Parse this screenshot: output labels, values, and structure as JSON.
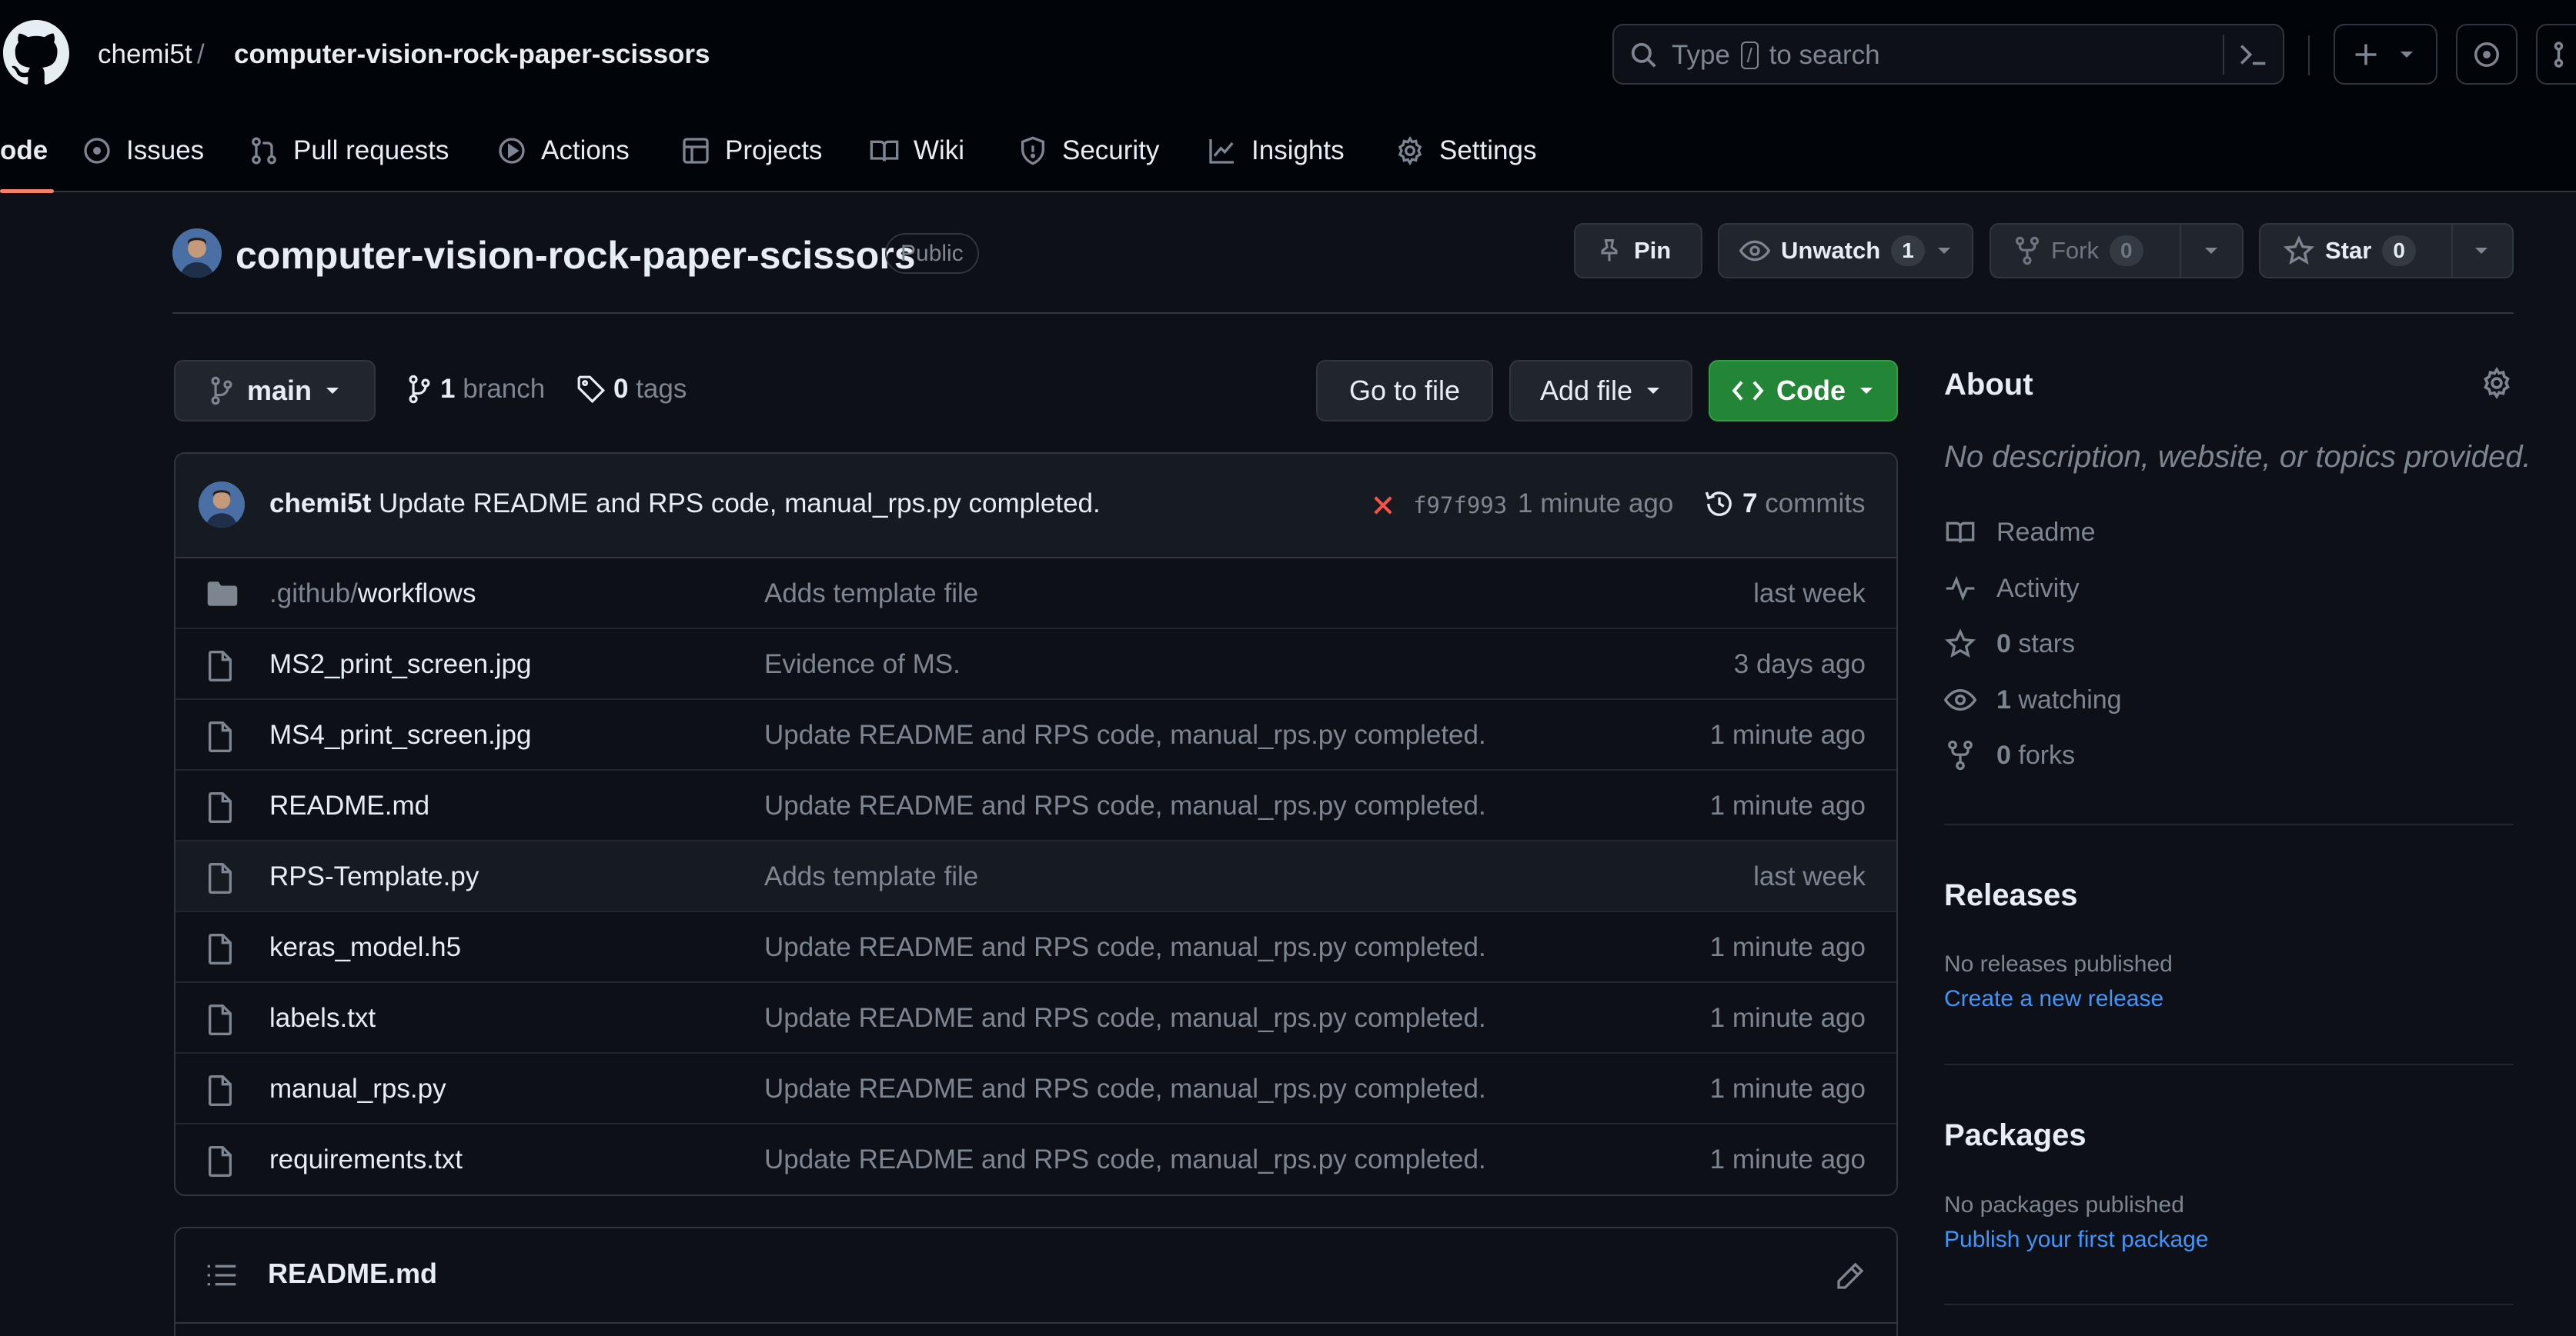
{
  "header": {
    "owner": "chemi5t",
    "separator": "/",
    "repo": "computer-vision-rock-paper-scissors",
    "search": {
      "prefix": "Type",
      "key": "/",
      "suffix": "to search"
    }
  },
  "tabs": [
    {
      "label": "ode",
      "icon": "code-icon"
    },
    {
      "label": "Issues",
      "icon": "issue-icon"
    },
    {
      "label": "Pull requests",
      "icon": "pull-request-icon"
    },
    {
      "label": "Actions",
      "icon": "play-icon"
    },
    {
      "label": "Projects",
      "icon": "table-icon"
    },
    {
      "label": "Wiki",
      "icon": "book-icon"
    },
    {
      "label": "Security",
      "icon": "shield-icon"
    },
    {
      "label": "Insights",
      "icon": "graph-icon"
    },
    {
      "label": "Settings",
      "icon": "gear-icon"
    }
  ],
  "repo_head": {
    "title": "computer-vision-rock-paper-scissors",
    "visibility": "Public",
    "pin_label": "Pin",
    "unwatch_label": "Unwatch",
    "watch_count": "1",
    "fork_label": "Fork",
    "fork_count": "0",
    "star_label": "Star",
    "star_count": "0"
  },
  "filebar": {
    "branch": "main",
    "branch_count": "1",
    "branch_label": "branch",
    "tag_count": "0",
    "tag_label": "tags",
    "go_to_file": "Go to file",
    "add_file": "Add file",
    "code": "Code"
  },
  "latest_commit": {
    "author": "chemi5t",
    "message": "Update README and RPS code, manual_rps.py completed.",
    "sha": "f97f993",
    "time": "1 minute ago",
    "commit_count": "7",
    "commit_label": "commits"
  },
  "files": [
    {
      "dir_prefix": ".github/",
      "name": "workflows",
      "type": "folder",
      "commit": "Adds template file",
      "age": "last week"
    },
    {
      "dir_prefix": "",
      "name": "MS2_print_screen.jpg",
      "type": "file",
      "commit": "Evidence of MS.",
      "age": "3 days ago"
    },
    {
      "dir_prefix": "",
      "name": "MS4_print_screen.jpg",
      "type": "file",
      "commit": "Update README and RPS code, manual_rps.py completed.",
      "age": "1 minute ago"
    },
    {
      "dir_prefix": "",
      "name": "README.md",
      "type": "file",
      "commit": "Update README and RPS code, manual_rps.py completed.",
      "age": "1 minute ago"
    },
    {
      "dir_prefix": "",
      "name": "RPS-Template.py",
      "type": "file",
      "commit": "Adds template file",
      "age": "last week"
    },
    {
      "dir_prefix": "",
      "name": "keras_model.h5",
      "type": "file",
      "commit": "Update README and RPS code, manual_rps.py completed.",
      "age": "1 minute ago"
    },
    {
      "dir_prefix": "",
      "name": "labels.txt",
      "type": "file",
      "commit": "Update README and RPS code, manual_rps.py completed.",
      "age": "1 minute ago"
    },
    {
      "dir_prefix": "",
      "name": "manual_rps.py",
      "type": "file",
      "commit": "Update README and RPS code, manual_rps.py completed.",
      "age": "1 minute ago"
    },
    {
      "dir_prefix": "",
      "name": "requirements.txt",
      "type": "file",
      "commit": "Update README and RPS code, manual_rps.py completed.",
      "age": "1 minute ago"
    }
  ],
  "readme": {
    "title": "README.md"
  },
  "sidebar": {
    "about_title": "About",
    "description": "No description, website, or topics provided.",
    "links": [
      {
        "icon": "book-icon",
        "count": "",
        "label": "Readme"
      },
      {
        "icon": "pulse-icon",
        "count": "",
        "label": "Activity"
      },
      {
        "icon": "star-icon",
        "count": "0",
        "label": "stars"
      },
      {
        "icon": "eye-icon",
        "count": "1",
        "label": "watching"
      },
      {
        "icon": "fork-icon",
        "count": "0",
        "label": "forks"
      }
    ],
    "releases_title": "Releases",
    "releases_none": "No releases published",
    "releases_link": "Create a new release",
    "packages_title": "Packages",
    "packages_none": "No packages published",
    "packages_link": "Publish your first package"
  },
  "colors": {
    "background": "#0d1117",
    "header_bg": "#010409",
    "border": "#30363d",
    "muted": "#7d8590",
    "accent_link": "#4493f8",
    "code_button": "#238636",
    "active_tab_underline": "#f78166",
    "status_fail": "#f85149"
  }
}
